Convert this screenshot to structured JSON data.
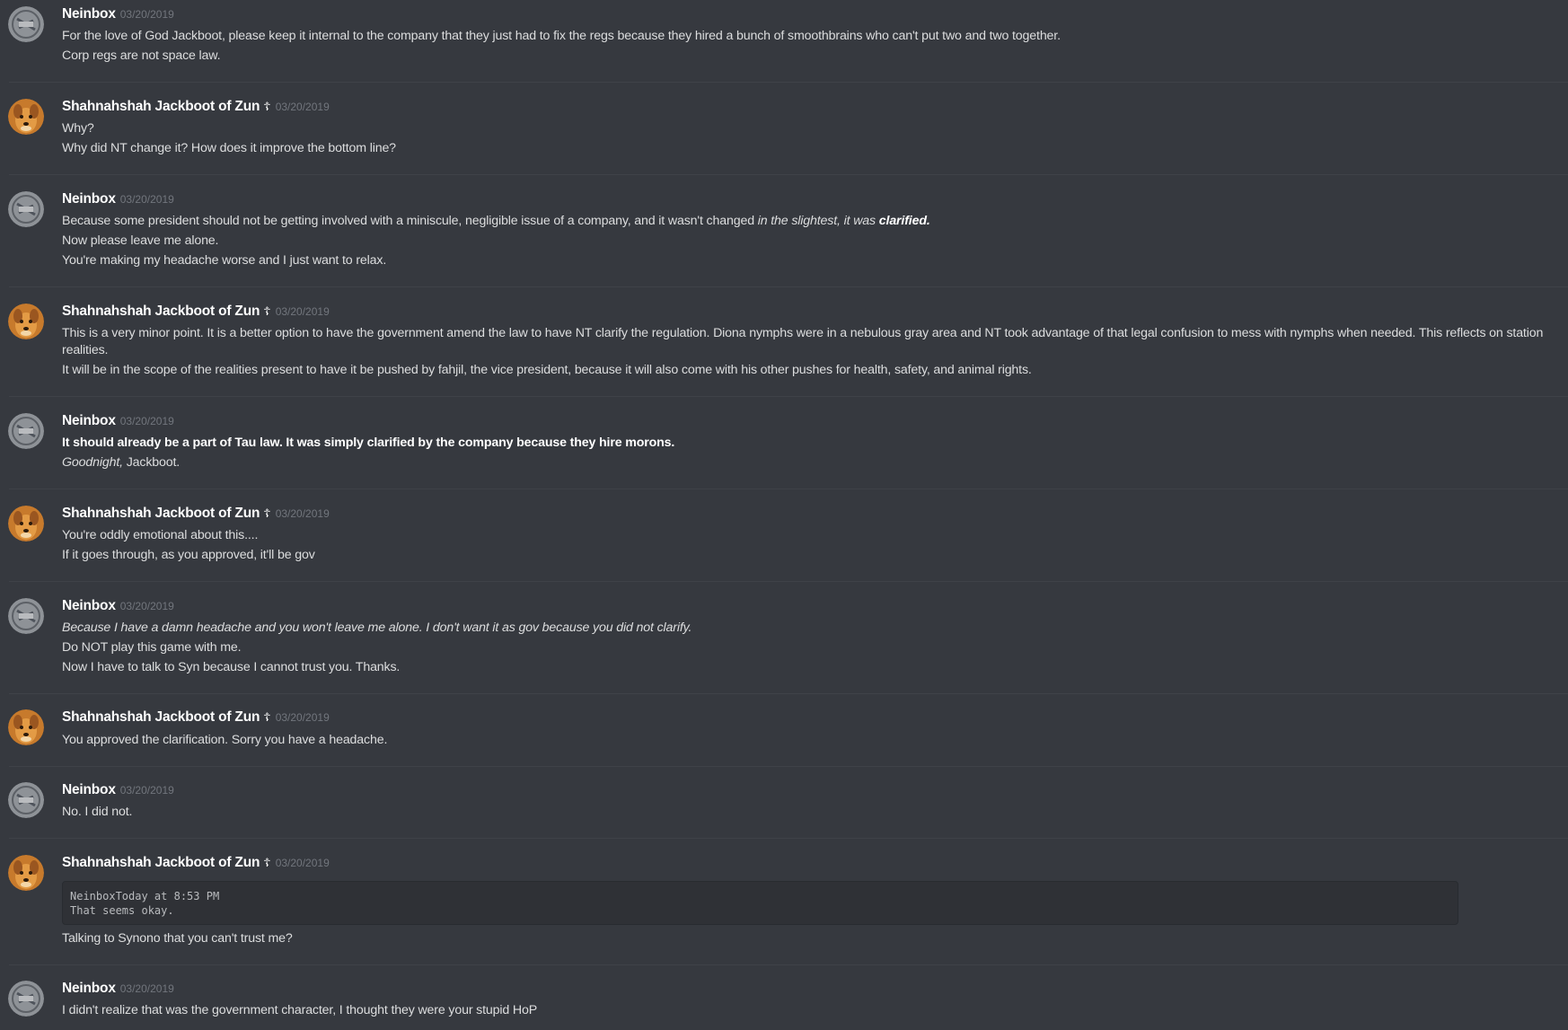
{
  "users": {
    "neinbox": "Neinbox",
    "jackboot": "Shahnahshah Jackboot of Zun",
    "jackboot_badge": "☦"
  },
  "avatars": {
    "neinbox": "gray-stamp-avatar",
    "jackboot": "golden-dog-avatar"
  },
  "messages": [
    {
      "author": "Neinbox",
      "timestamp": "03/20/2019",
      "lines": [
        {
          "text": "For the love of God Jackboot, please keep it internal to the company that they just had to fix the regs because they hired a bunch of smoothbrains who can't put two and two together."
        },
        {
          "text": "Corp regs are not space law."
        }
      ]
    },
    {
      "author": "Shahnahshah Jackboot of Zun",
      "timestamp": "03/20/2019",
      "lines": [
        {
          "text": "Why?"
        },
        {
          "text": "Why did NT change it? How does it improve the bottom line?"
        }
      ]
    },
    {
      "author": "Neinbox",
      "timestamp": "03/20/2019",
      "lines": [
        {
          "text": "Because some president should not be getting involved with a miniscule, negligible issue of a company, and it wasn't changed ",
          "italic": "in the slightest, it was ",
          "bolditalic": "clarified."
        },
        {
          "text": "Now please leave me alone."
        },
        {
          "text": "You're making my headache worse and I just want to relax."
        }
      ]
    },
    {
      "author": "Shahnahshah Jackboot of Zun",
      "timestamp": "03/20/2019",
      "lines": [
        {
          "text": "This is a very minor point. It is a better option to have the government amend the law to have NT clarify the regulation. Diona nymphs were in a nebulous gray area and NT took advantage of that legal confusion to mess with nymphs when needed. This reflects on station realities."
        },
        {
          "text": "It will be in the scope of the realities present to have it be pushed by fahjil, the vice president, because it will also come with his other pushes for health, safety, and animal rights."
        }
      ]
    },
    {
      "author": "Neinbox",
      "timestamp": "03/20/2019",
      "lines": [
        {
          "bold": "It should already be a part of Tau law. It was simply clarified by the company because they hire morons."
        },
        {
          "italic": "Goodnight,",
          "text": " Jackboot."
        }
      ]
    },
    {
      "author": "Shahnahshah Jackboot of Zun",
      "timestamp": "03/20/2019",
      "lines": [
        {
          "text": "You're oddly emotional about this...."
        },
        {
          "text": "If it goes through, as you approved, it'll be gov"
        }
      ]
    },
    {
      "author": "Neinbox",
      "timestamp": "03/20/2019",
      "lines": [
        {
          "italic": "Because I have a damn headache and you won't leave me alone. I don't want it as gov because you did not clarify."
        },
        {
          "text": "Do NOT play this game with me."
        },
        {
          "text": "Now I have to talk to Syn because I cannot trust you. Thanks."
        }
      ]
    },
    {
      "author": "Shahnahshah Jackboot of Zun",
      "timestamp": "03/20/2019",
      "lines": [
        {
          "text": "You approved the clarification. Sorry you have a headache."
        }
      ]
    },
    {
      "author": "Neinbox",
      "timestamp": "03/20/2019",
      "lines": [
        {
          "text": "No. I did not."
        }
      ]
    },
    {
      "author": "Shahnahshah Jackboot of Zun",
      "timestamp": "03/20/2019",
      "code": "NeinboxToday at 8:53 PM\nThat seems okay.",
      "lines": [
        {
          "text": "Talking to Synono that you can't trust me?"
        }
      ]
    },
    {
      "author": "Neinbox",
      "timestamp": "03/20/2019",
      "lines": [
        {
          "text": "I didn't realize that was the government character, I thought they were your stupid HoP"
        }
      ]
    }
  ]
}
